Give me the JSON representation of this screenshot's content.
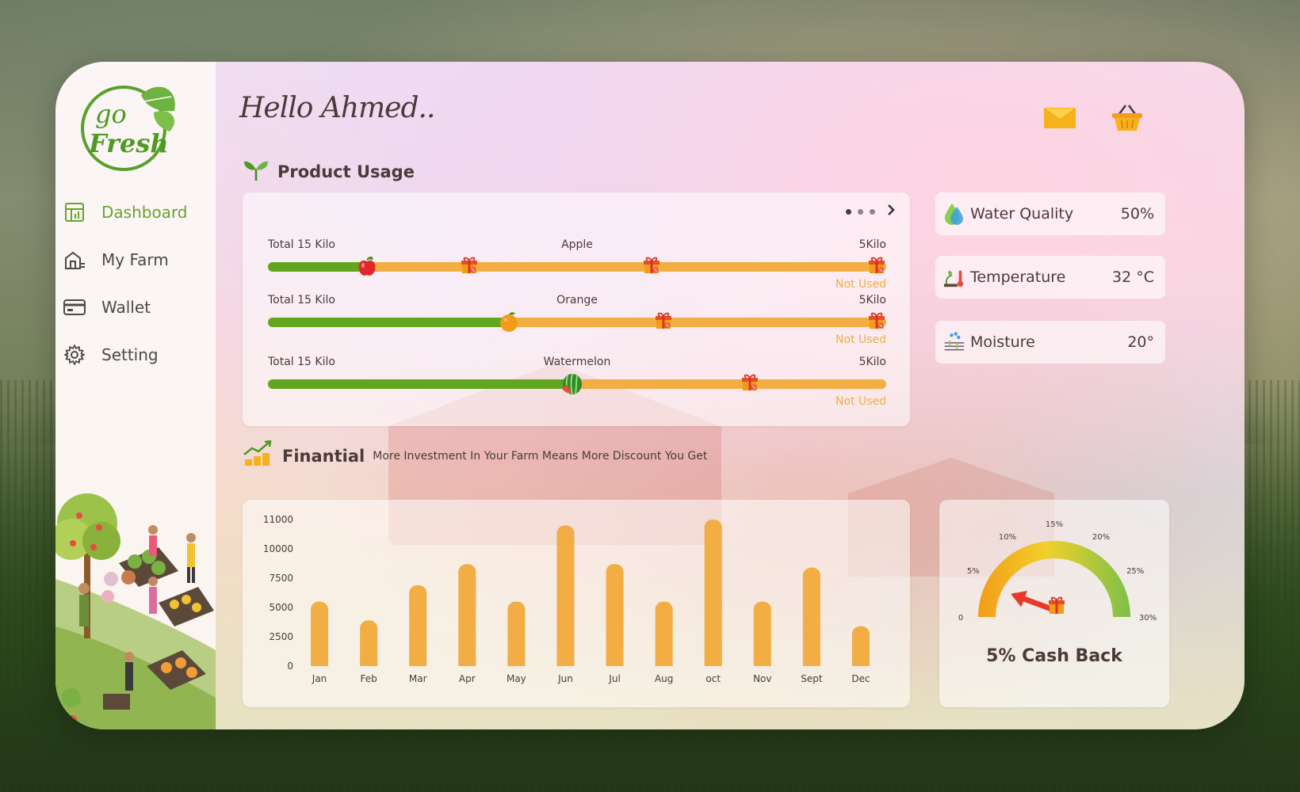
{
  "app": {
    "greeting": "Hello Ahmed..",
    "logo_text_top": "go",
    "logo_text_bottom": "Fresh"
  },
  "sidebar": {
    "items": [
      {
        "label": "Dashboard",
        "icon": "dashboard-icon",
        "active": true
      },
      {
        "label": "My Farm",
        "icon": "farm-icon",
        "active": false
      },
      {
        "label": "Wallet",
        "icon": "wallet-icon",
        "active": false
      },
      {
        "label": "Setting",
        "icon": "gear-icon",
        "active": false
      }
    ]
  },
  "header": {
    "mail_icon": "mail-icon",
    "basket_icon": "basket-icon"
  },
  "product_usage": {
    "title": "Product Usage",
    "rows": [
      {
        "total": "Total 15 Kilo",
        "name": "Apple",
        "unit": "5Kilo",
        "status": "Not Used",
        "progress": 0.16,
        "marker": "apple"
      },
      {
        "total": "Total 15 Kilo",
        "name": "Orange",
        "unit": "5Kilo",
        "status": "Not Used",
        "progress": 0.39,
        "marker": "orange"
      },
      {
        "total": "Total 15 Kilo",
        "name": "Watermelon",
        "unit": "5Kilo",
        "status": "Not Used",
        "progress": 0.49,
        "marker": "watermelon"
      }
    ]
  },
  "metrics": [
    {
      "label": "Water Quality",
      "value": "50%",
      "icon": "water-drop-icon"
    },
    {
      "label": "Temperature",
      "value": "32 °C",
      "icon": "thermometer-icon"
    },
    {
      "label": "Moisture",
      "value": "20°",
      "icon": "moisture-icon"
    }
  ],
  "financial": {
    "title": "Finantial",
    "subtitle": "More Investment In Your Farm Means More Discount You Get"
  },
  "chart_data": {
    "type": "bar",
    "title": "",
    "xlabel": "",
    "ylabel": "",
    "categories": [
      "Jan",
      "Feb",
      "Mar",
      "Apr",
      "May",
      "Jun",
      "Jul",
      "Aug",
      "oct",
      "Nov",
      "Sept",
      "Dec"
    ],
    "values": [
      5500,
      3900,
      6900,
      8700,
      5500,
      10800,
      8700,
      5500,
      11600,
      5500,
      8400,
      3400
    ],
    "y_ticks": [
      "0",
      "2500",
      "5000",
      "7500",
      "10000",
      "11000"
    ],
    "bar_color": "#f2ad44",
    "grid": false
  },
  "gauge": {
    "ticks": [
      "0",
      "5%",
      "10%",
      "15%",
      "20%",
      "25%",
      "30%"
    ],
    "value_percent": 5,
    "label": "5% Cash Back"
  }
}
